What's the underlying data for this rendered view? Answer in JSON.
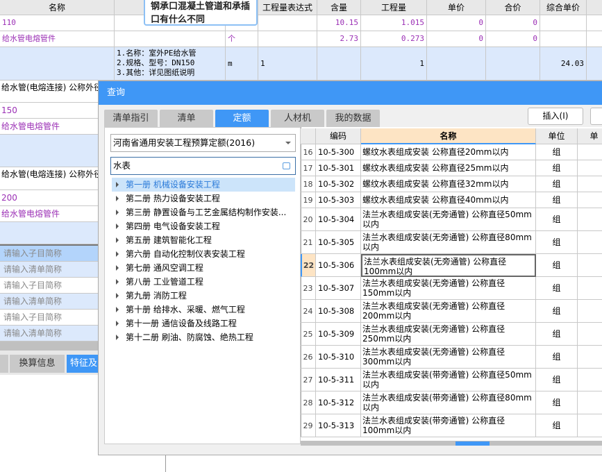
{
  "bg_table": {
    "headers": [
      "名称",
      "",
      "",
      "工程量表达式",
      "含量",
      "工程量",
      "单价",
      "合价",
      "综合单价",
      ""
    ],
    "rows": [
      {
        "name": "110",
        "content": "10.15",
        "qty": "1.015",
        "price": "0",
        "total": "0"
      },
      {
        "name": "给水管电熔管件",
        "unit": "个",
        "content": "2.73",
        "qty": "0.273",
        "price": "0",
        "total": "0"
      },
      {
        "desc": [
          "1.名称：室外PE给水管",
          "2.规格、型号：DN150",
          "3.其他：详见图纸说明"
        ],
        "unit": "m",
        "expr": "1",
        "qty": "1",
        "unit_price": "24.03"
      }
    ],
    "left_rows": [
      "给水管(电熔连接) 公称外径",
      "150",
      "给水管电熔管件",
      "",
      "给水管(电熔连接) 公称外径",
      "200",
      "给水管电熔管件",
      ""
    ],
    "placeholders": [
      "请输入子目简称",
      "请输入清单简称",
      "请输入子目简称",
      "请输入清单简称",
      "请输入子目简称",
      "请输入清单简称"
    ],
    "bottom_tabs": [
      "",
      "换算信息",
      "特征及"
    ]
  },
  "tooltip": "钢承口混凝土管道和承插口有什么不同",
  "dialog": {
    "title": "查询",
    "tabs": [
      "清单指引",
      "清单",
      "定额",
      "人材机",
      "我的数据"
    ],
    "active_tab": "定额",
    "insert_button": "插入(I)",
    "quota_select": "河南省通用安装工程预算定额(2016)",
    "search_value": "水表",
    "tree": [
      "第一册 机械设备安装工程",
      "第二册 热力设备安装工程",
      "第三册 静置设备与工艺金属结构制作安装...",
      "第四册 电气设备安装工程",
      "第五册 建筑智能化工程",
      "第六册 自动化控制仪表安装工程",
      "第七册 通风空调工程",
      "第八册 工业管道工程",
      "第九册 消防工程",
      "第十册 给排水、采暖、燃气工程",
      "第十一册 通信设备及线路工程",
      "第十二册 刷油、防腐蚀、绝热工程"
    ],
    "grid": {
      "headers": [
        "",
        "编码",
        "名称",
        "单位",
        "单"
      ],
      "rows": [
        {
          "no": "16",
          "code": "10-5-300",
          "name": "螺纹水表组成安装 公称直径20mm以内",
          "unit": "组"
        },
        {
          "no": "17",
          "code": "10-5-301",
          "name": "螺纹水表组成安装 公称直径25mm以内",
          "unit": "组"
        },
        {
          "no": "18",
          "code": "10-5-302",
          "name": "螺纹水表组成安装 公称直径32mm以内",
          "unit": "组"
        },
        {
          "no": "19",
          "code": "10-5-303",
          "name": "螺纹水表组成安装 公称直径40mm以内",
          "unit": "组"
        },
        {
          "no": "20",
          "code": "10-5-304",
          "name": "法兰水表组成安装(无旁通管) 公称直径50mm以内",
          "unit": "组"
        },
        {
          "no": "21",
          "code": "10-5-305",
          "name": "法兰水表组成安装(无旁通管) 公称直径80mm以内",
          "unit": "组"
        },
        {
          "no": "22",
          "code": "10-5-306",
          "name": "法兰水表组成安装(无旁通管) 公称直径100mm以内",
          "unit": "组"
        },
        {
          "no": "23",
          "code": "10-5-307",
          "name": "法兰水表组成安装(无旁通管) 公称直径150mm以内",
          "unit": "组"
        },
        {
          "no": "24",
          "code": "10-5-308",
          "name": "法兰水表组成安装(无旁通管) 公称直径200mm以内",
          "unit": "组"
        },
        {
          "no": "25",
          "code": "10-5-309",
          "name": "法兰水表组成安装(无旁通管) 公称直径250mm以内",
          "unit": "组"
        },
        {
          "no": "26",
          "code": "10-5-310",
          "name": "法兰水表组成安装(无旁通管) 公称直径300mm以内",
          "unit": "组"
        },
        {
          "no": "27",
          "code": "10-5-311",
          "name": "法兰水表组成安装(带旁通管) 公称直径50mm以内",
          "unit": "组"
        },
        {
          "no": "28",
          "code": "10-5-312",
          "name": "法兰水表组成安装(带旁通管) 公称直径80mm以内",
          "unit": "组"
        },
        {
          "no": "29",
          "code": "10-5-313",
          "name": "法兰水表组成安装(带旁通管) 公称直径100mm以内",
          "unit": "组"
        }
      ],
      "selected_row": "22"
    }
  },
  "colors": {
    "accent": "#3f97f6",
    "purple": "#9b2fb5",
    "row_blue": "#dce9fc",
    "header_active": "#fde4c4"
  }
}
